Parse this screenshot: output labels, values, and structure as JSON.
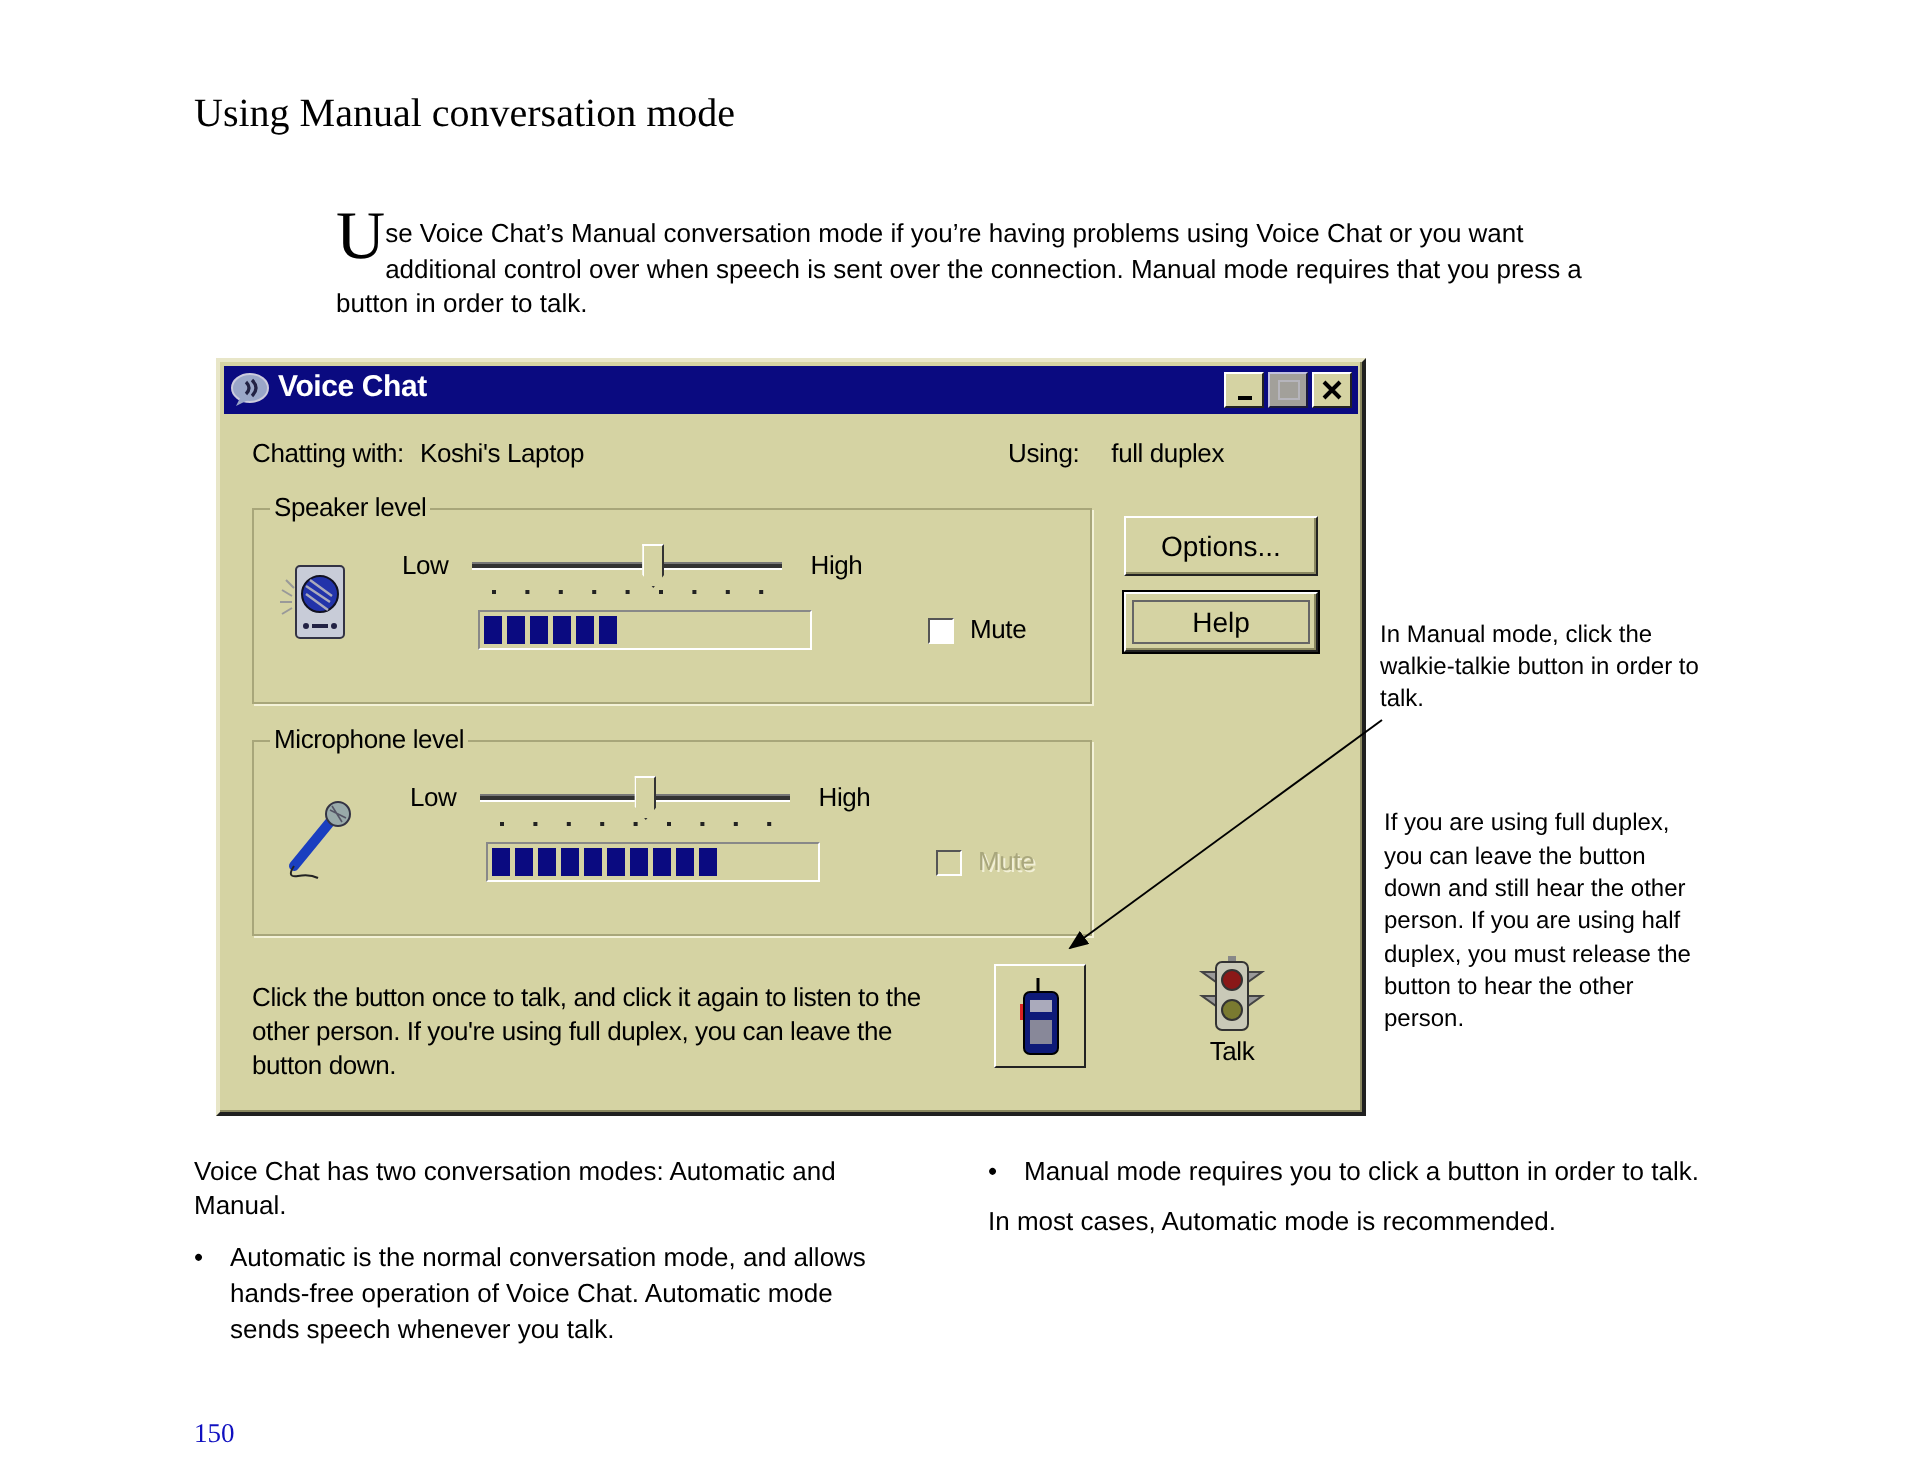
{
  "heading": "Using Manual conversation mode",
  "intro": "Use Voice Chat’s Manual conversation mode if you’re having problems using Voice Chat or you want additional control over when speech is sent over the connection. Manual mode requires that you press a button in order to talk.",
  "window": {
    "title": "Voice Chat",
    "title_buttons": [
      {
        "kind": "minimize",
        "disabled": false
      },
      {
        "kind": "maximize",
        "disabled": true
      },
      {
        "kind": "close",
        "disabled": false
      }
    ],
    "chatting_label": "Chatting with:",
    "chatting_value": "Koshi's Laptop",
    "using_label": "Using:",
    "using_value": "full duplex",
    "groups": [
      {
        "title": "Speaker level",
        "kind": "speaker",
        "low": "Low",
        "high": "High",
        "slider": {
          "level": 0.58
        },
        "meter": {
          "level": 0.43
        },
        "mute": {
          "label": "Mute",
          "checked": false,
          "disabled": false
        }
      },
      {
        "title": "Microphone level",
        "kind": "microphone",
        "low": "Low",
        "high": "High",
        "slider": {
          "level": 0.53
        },
        "meter": {
          "level": 0.71
        },
        "mute": {
          "label": "Mute",
          "checked": false,
          "disabled": true
        }
      }
    ],
    "buttons": [
      {
        "label": "Options...",
        "focused": false
      },
      {
        "label": "Help",
        "focused": true
      }
    ],
    "instructions": "Click the button once to talk, and click it again to listen to the other person.  If you're using full duplex, you can leave the button down.",
    "talk_label": "Talk"
  },
  "callouts": [
    "In Manual mode, click the walkie-talkie button in order to talk.",
    "If you are using full duplex, you can leave the button down and still hear the other person. If you are using half duplex, you must release the button to hear the other person."
  ],
  "body_left": [
    {
      "kind": "paragraph",
      "text": "Voice Chat has two conversation modes: Automatic and Manual."
    },
    {
      "kind": "bullet",
      "bullet": "•",
      "text": "Automatic is the normal conversation mode, and allows hands-free operation of Voice Chat. Automatic mode sends speech whenever you talk."
    }
  ],
  "body_right": [
    {
      "kind": "bullet",
      "bullet": "•",
      "text": "Manual mode requires you to click a button in order to talk."
    },
    {
      "kind": "paragraph",
      "text": "In most cases, Automatic mode is recommended."
    }
  ],
  "page_number": "150"
}
